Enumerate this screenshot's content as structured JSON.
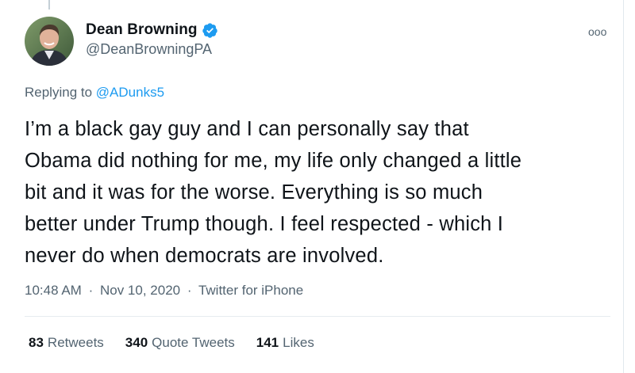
{
  "author": {
    "display_name": "Dean Browning",
    "handle": "@DeanBrowningPA",
    "verified": true
  },
  "more_menu": "ooo",
  "reply": {
    "prefix": "Replying to ",
    "mention": "@ADunks5"
  },
  "tweet": {
    "lines": [
      "I’m a black gay guy and I can personally say that",
      "Obama did nothing for me, my life only changed a little",
      "bit and it was for the worse. Everything is so much",
      "better under Trump though. I feel respected - which I",
      "never do when democrats are involved."
    ]
  },
  "meta": {
    "time": "10:48 AM",
    "date": "Nov 10, 2020",
    "source": "Twitter for iPhone",
    "separator": "·"
  },
  "stats": {
    "retweets": {
      "count": "83",
      "label": "Retweets"
    },
    "quote_tweets": {
      "count": "340",
      "label": "Quote Tweets"
    },
    "likes": {
      "count": "141",
      "label": "Likes"
    }
  },
  "colors": {
    "link": "#1d9bf0",
    "secondary_text": "#536471",
    "primary_text": "#0f1419",
    "verified_badge": "#1d9bf0"
  }
}
